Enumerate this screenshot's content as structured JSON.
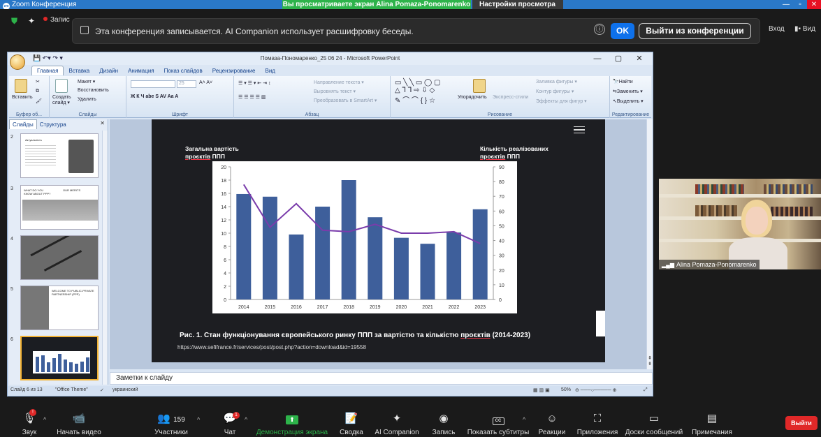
{
  "titlebar": {
    "app_title": "Zoom Конференция",
    "sharing_notice": "Вы просматриваете экран Alina Pomaza-Ponomarenko",
    "view_options": "Настройки просмотра",
    "view_caret": "⌄",
    "minimize": "—",
    "restore": "▫",
    "close": "✕"
  },
  "topbar": {
    "record_label": "Запис",
    "banner_text": "Эта конференция записывается. AI Companion использует расшифровку беседы.",
    "ok_label": "OK",
    "leave_label": "Выйти из конференции",
    "signin_label": "Вход",
    "view_label": "Вид",
    "info_glyph": "ⓘ"
  },
  "ppt": {
    "title": "Помаза-Пономаренко_25 06 24  -  Microsoft PowerPoint",
    "tabs": [
      "Главная",
      "Вставка",
      "Дизайн",
      "Анимация",
      "Показ слайдов",
      "Рецензирование",
      "Вид"
    ],
    "ribbon": {
      "paste": "Вставить",
      "clipboard_group": "Буфер об...",
      "layout": "Макет ▾",
      "reset": "Восстановить",
      "new_slide": "Создать слайд ▾",
      "delete": "Удалить",
      "slides_group": "Слайды",
      "font_size": "25",
      "font_group": "Шрифт",
      "text_direction": "Направление текста ▾",
      "align_text": "Выровнять текст ▾",
      "smartart": "Преобразовать в SmartArt ▾",
      "paragraph_group": "Абзац",
      "arrange": "Упорядочить",
      "quick_styles": "Экспресс-стили",
      "fill": "Заливка фигуры ▾",
      "outline": "Контур фигуры ▾",
      "effects": "Эффекты для фигур ▾",
      "drawing_group": "Рисование",
      "find": "Найти",
      "replace": "Заменить ▾",
      "select": "Выделить ▾",
      "editing_group": "Редактирование"
    },
    "pane_tabs": [
      "Слайды",
      "Структура"
    ],
    "thumb_numbers": [
      "2",
      "3",
      "4",
      "5",
      "6"
    ],
    "thumb_texts": [
      "Актуальність",
      "WHAT DO YOU KNOW ABOUT PPP?",
      "OUR MERITS",
      "WELCOME TO PUBLIC-PRIVATE PARTNERSHIP (PPP)"
    ],
    "notes_placeholder": "Заметки к слайду",
    "status": {
      "slide": "Слайд 6 из 13",
      "theme": "\"Office Theme\"",
      "language": "украинский",
      "zoom": "50%"
    }
  },
  "slide": {
    "left_label_1": "Загальна вартість",
    "left_label_2": "проєктів",
    "left_label_3": "ППП",
    "right_label_1": "Кількість реалізованих",
    "right_label_2": "проєктів",
    "right_label_3": "ППП",
    "caption_1": "Рис. 1. Стан функціонування європейського ринку  ППП  за вартістю та кількістю ",
    "caption_2": "проєктів",
    "caption_3": " (2014-2023)",
    "source": "https://www.sefifrance.fr/services/post/post.php?action=download&id=19558"
  },
  "chart_data": {
    "type": "bar",
    "categories": [
      "2014",
      "2015",
      "2016",
      "2017",
      "2018",
      "2019",
      "2020",
      "2021",
      "2022",
      "2023"
    ],
    "series": [
      {
        "values": [
          15.9,
          15.5,
          9.8,
          14.0,
          18.0,
          12.4,
          9.3,
          8.4,
          10.1,
          13.6
        ],
        "axis": "left",
        "color": "#3e5f9b"
      },
      {
        "values": [
          78,
          49,
          65,
          47,
          46,
          51,
          45,
          45,
          46,
          38
        ],
        "axis": "right",
        "color": "#7a3cab"
      }
    ],
    "y_left": {
      "min": 0,
      "max": 20,
      "ticks": [
        "0",
        "2",
        "4",
        "6",
        "8",
        "10",
        "12",
        "14",
        "16",
        "18",
        "20"
      ]
    },
    "y_right": {
      "min": 0,
      "max": 90,
      "ticks": [
        "0",
        "10",
        "20",
        "30",
        "40",
        "50",
        "60",
        "70",
        "80",
        "90"
      ]
    },
    "grid": false
  },
  "participant": {
    "name": "Alina Pomaza-Ponomarenko"
  },
  "toolbar": {
    "mute": "Звук",
    "video": "Начать видео",
    "participants": "Участники",
    "participants_count": "159",
    "chat": "Чат",
    "chat_badge": "1",
    "share": "Демонстрация экрана",
    "summary": "Сводка",
    "companion": "AI Companion",
    "record": "Запись",
    "captions": "Показать субтитры",
    "captions_icon": "CC",
    "reactions": "Реакции",
    "apps": "Приложения",
    "whiteboards": "Доски сообщений",
    "notes": "Примечания",
    "leave": "Выйти",
    "caret": "^"
  },
  "colors": {
    "zoom_blue": "#0e71eb",
    "share_green": "#2db34a",
    "leave_red": "#e02828",
    "bar_blue": "#3e5f9b",
    "line_purple": "#7a3cab"
  }
}
